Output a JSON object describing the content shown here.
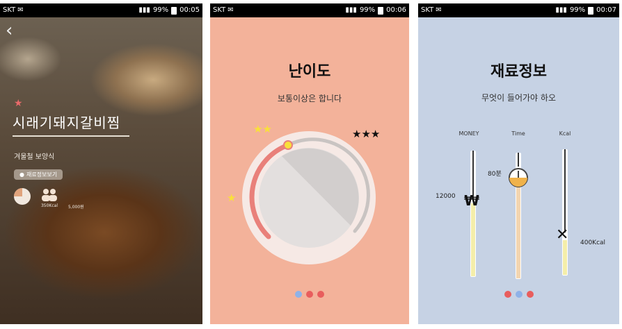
{
  "status_bars": [
    {
      "carrier": "SKT",
      "battery": "99%",
      "time": "00:05"
    },
    {
      "carrier": "SKT",
      "battery": "99%",
      "time": "00:06"
    },
    {
      "carrier": "SKT",
      "battery": "99%",
      "time": "00:07"
    }
  ],
  "recipe_screen": {
    "back_icon": "chevron-left-icon",
    "title": "시래기돼지갈비찜",
    "subtitle": "겨울철 보양식",
    "info_button": "재료정보보기",
    "stats": {
      "difficulty_level": 0.25,
      "servings": "350Kcal",
      "price": "5,000원"
    },
    "colors": {
      "accent_star": "#e86a6a"
    }
  },
  "difficulty_screen": {
    "title": "난이도",
    "subtitle": "보통이상은 합니다",
    "stars_low": "★",
    "stars_mid": "★★",
    "stars_high": "★★★",
    "dial_level": 0.5,
    "page_dots_active": 1,
    "colors": {
      "background": "#f3b29a",
      "star_yellow": "#f9e03a",
      "arc": "#e9807a",
      "knob": "#f3b9a3"
    }
  },
  "ingredient_screen": {
    "title": "재료정보",
    "subtitle": "무엇이 들어가야 하오",
    "columns": [
      {
        "label": "MONEY",
        "value_label": "12000",
        "icon": "won-sign-icon",
        "level": 0.55
      },
      {
        "label": "Time",
        "value_label": "80분",
        "icon": "clock-icon",
        "level": 0.88
      },
      {
        "label": "Kcal",
        "value_label": "400Kcal",
        "icon": "utensils-icon",
        "level": 0.3
      }
    ],
    "page_dots_active": 2,
    "colors": {
      "background": "#c6d2e4",
      "money_fill": "#f4eeaa",
      "time_fill": "#f3d5b0",
      "kcal_fill": "#f4eeaa"
    }
  }
}
